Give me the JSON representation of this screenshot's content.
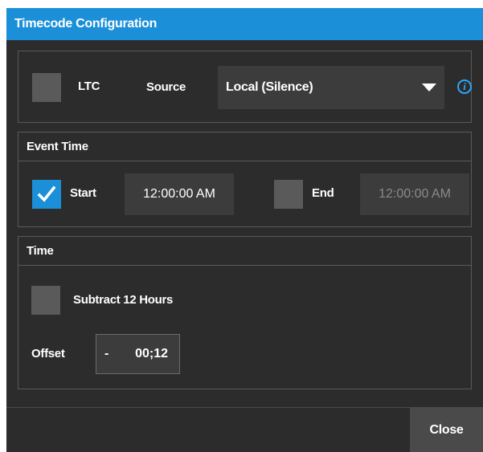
{
  "dialog": {
    "title": "Timecode Configuration",
    "accent_color": "#1b8fd8"
  },
  "ltc": {
    "checkbox_checked": false,
    "label": "LTC",
    "source_label": "Source",
    "source_value": "Local (Silence)",
    "info_icon": "i"
  },
  "event_time": {
    "header": "Event Time",
    "start": {
      "checked": true,
      "label": "Start",
      "value": "12:00:00 AM"
    },
    "end": {
      "checked": false,
      "label": "End",
      "value": "12:00:00 AM",
      "disabled": true
    }
  },
  "time": {
    "header": "Time",
    "subtract": {
      "checked": false,
      "label": "Subtract 12 Hours"
    },
    "offset_label": "Offset",
    "offset_sign": "-",
    "offset_value": "00;12"
  },
  "footer": {
    "close_label": "Close"
  }
}
